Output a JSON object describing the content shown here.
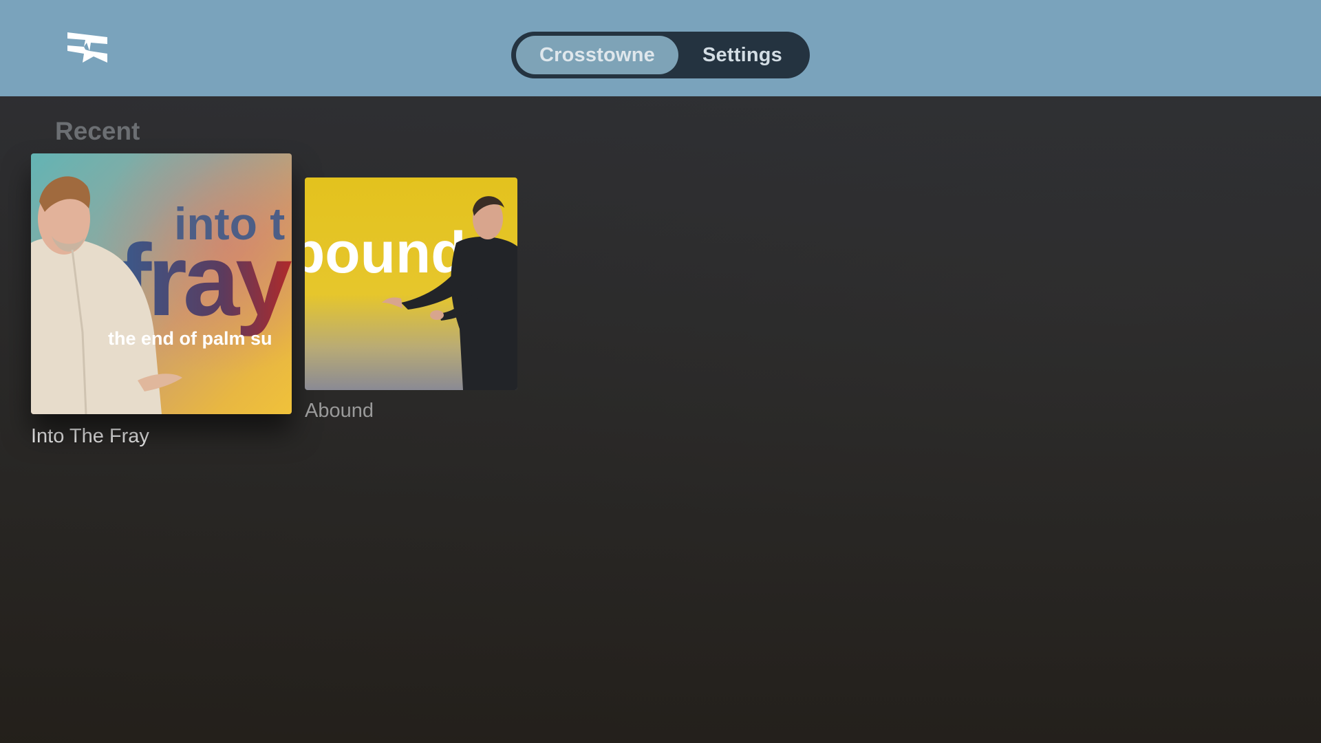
{
  "header": {
    "logo_icon": "crosstowne-logo-icon",
    "tabs": [
      {
        "label": "Crosstowne",
        "selected": true
      },
      {
        "label": "Settings",
        "selected": false
      }
    ],
    "background_color": "#7aa3bc"
  },
  "recent": {
    "title": "Recent",
    "items": [
      {
        "title": "Into The Fray",
        "artwork_text": {
          "line1": "into t",
          "line2": "fray",
          "line3": "the end of palm su"
        },
        "focused": true
      },
      {
        "title": "Abound",
        "artwork_text": {
          "line1": "bound"
        },
        "focused": false
      }
    ]
  }
}
